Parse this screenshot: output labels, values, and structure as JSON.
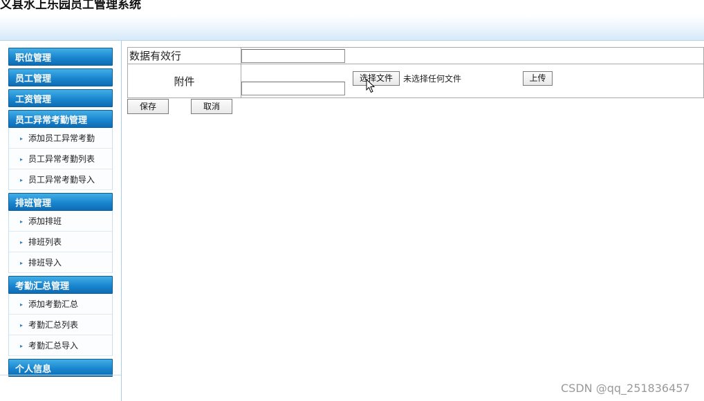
{
  "header": {
    "title": "义县水上乐园员工管理系统"
  },
  "sidebar": {
    "categories": [
      {
        "label": "职位管理",
        "items": []
      },
      {
        "label": "员工管理",
        "items": []
      },
      {
        "label": "工资管理",
        "items": []
      },
      {
        "label": "员工异常考勤管理",
        "items": [
          "添加员工异常考勤",
          "员工异常考勤列表",
          "员工异常考勤导入"
        ]
      },
      {
        "label": "排班管理",
        "items": [
          "添加排班",
          "排班列表",
          "排班导入"
        ]
      },
      {
        "label": "考勤汇总管理",
        "items": [
          "添加考勤汇总",
          "考勤汇总列表",
          "考勤汇总导入"
        ]
      },
      {
        "label": "个人信息",
        "items": []
      }
    ]
  },
  "form": {
    "valid_rows_label": "数据有效行",
    "valid_rows_value": "",
    "attachment_label": "附件",
    "choose_file_label": "选择文件",
    "no_file_text": "未选择任何文件",
    "upload_label": "上传",
    "attachment_value": ""
  },
  "actions": {
    "save_label": "保存",
    "cancel_label": "取消"
  },
  "watermark": "CSDN @qq_251836457"
}
